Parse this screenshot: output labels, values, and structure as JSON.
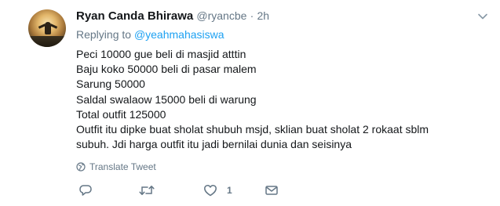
{
  "tweet": {
    "author_name": "Ryan Canda Bhirawa",
    "handle": "@ryancbe",
    "separator": "·",
    "time": "2h",
    "reply_prefix": "Replying to",
    "reply_to": "@yeahmahasiswa",
    "lines": [
      "Peci 10000 gue beli di masjid atttin",
      "Baju koko 50000 beli di pasar malem",
      "Sarung 50000",
      "Saldal swalaow 15000 beli di warung",
      "Total outfit 125000",
      "Outfit itu dipke buat sholat shubuh msjd, sklian buat sholat 2 rokaat sblm",
      "subuh. Jdi harga outfit itu jadi bernilai dunia dan seisinya"
    ],
    "translate_label": "Translate Tweet",
    "like_count": "1"
  },
  "colors": {
    "text": "#14171a",
    "secondary": "#657786",
    "link": "#1da1f2"
  },
  "icons": [
    "chevron-down-icon",
    "globe-icon",
    "reply-icon",
    "retweet-icon",
    "heart-icon",
    "envelope-icon"
  ]
}
